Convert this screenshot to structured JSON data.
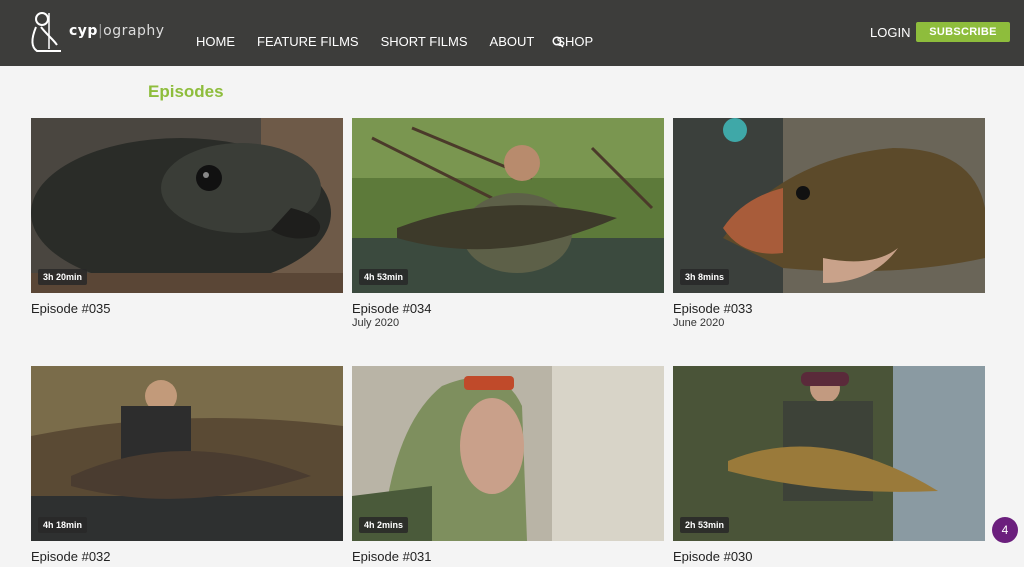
{
  "brand": {
    "bold": "cyp",
    "divider": "|",
    "rest": "ography"
  },
  "nav": [
    "HOME",
    "FEATURE FILMS",
    "SHORT FILMS",
    "ABOUT",
    "SHOP"
  ],
  "header": {
    "login": "LOGIN",
    "subscribe": "SUBSCRIBE"
  },
  "section_title": "Episodes",
  "episodes": [
    {
      "title": "Episode #035",
      "date": "",
      "duration": "3h 20min"
    },
    {
      "title": "Episode #034",
      "date": "July 2020",
      "duration": "4h 53min"
    },
    {
      "title": "Episode #033",
      "date": "June 2020",
      "duration": "3h 8mins"
    },
    {
      "title": "Episode #032",
      "date": "",
      "duration": "4h 18min"
    },
    {
      "title": "Episode #031",
      "date": "",
      "duration": "4h 2mins"
    },
    {
      "title": "Episode #030",
      "date": "",
      "duration": "2h 53min"
    }
  ],
  "chat_badge": "4",
  "colors": {
    "header": "#3d3d3b",
    "accent": "#8ebd3c",
    "badge": "#6b1f7d"
  }
}
